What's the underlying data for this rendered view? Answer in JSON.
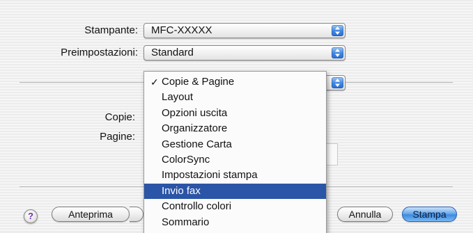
{
  "printer": {
    "label": "Stampante:",
    "value": "MFC-XXXXX"
  },
  "presets": {
    "label": "Preimpostazioni:",
    "value": "Standard"
  },
  "panel": {
    "copies_label": "Copie:",
    "pages_label": "Pagine:"
  },
  "menu": {
    "items": [
      {
        "label": "Copie & Pagine",
        "checked": true,
        "highlighted": false
      },
      {
        "label": "Layout",
        "checked": false,
        "highlighted": false
      },
      {
        "label": "Opzioni uscita",
        "checked": false,
        "highlighted": false
      },
      {
        "label": "Organizzatore",
        "checked": false,
        "highlighted": false
      },
      {
        "label": "Gestione Carta",
        "checked": false,
        "highlighted": false
      },
      {
        "label": "ColorSync",
        "checked": false,
        "highlighted": false
      },
      {
        "label": "Impostazioni stampa",
        "checked": false,
        "highlighted": false
      },
      {
        "label": "Invio fax",
        "checked": false,
        "highlighted": true
      },
      {
        "label": "Controllo colori",
        "checked": false,
        "highlighted": false
      },
      {
        "label": "Sommario",
        "checked": false,
        "highlighted": false
      }
    ],
    "check_glyph": "✓"
  },
  "buttons": {
    "help": "?",
    "preview": "Anteprima",
    "cancel": "Annulla",
    "print": "Stampa"
  },
  "colors": {
    "highlight": "#2b55a6",
    "accent_blue": "#3d8ae0",
    "help_glyph": "#6a2ea8"
  },
  "icons": {
    "popup_arrows": "up-down-arrows-icon",
    "help": "help-icon",
    "check": "checkmark-icon"
  }
}
